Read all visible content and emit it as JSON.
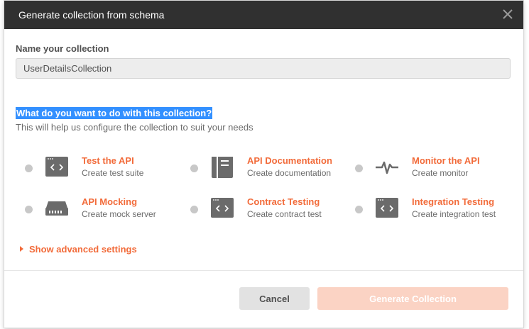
{
  "modal": {
    "title": "Generate collection from schema",
    "close_icon": "close-icon"
  },
  "form": {
    "name_label": "Name your collection",
    "name_value": "UserDetailsCollection",
    "question": "What do you want to do with this collection?",
    "helper": "This will help us configure the collection to suit your needs"
  },
  "options": [
    {
      "title": "Test the API",
      "desc": "Create test suite",
      "icon": "code-window-icon"
    },
    {
      "title": "API Documentation",
      "desc": "Create documentation",
      "icon": "document-icon"
    },
    {
      "title": "Monitor the API",
      "desc": "Create monitor",
      "icon": "pulse-icon"
    },
    {
      "title": "API Mocking",
      "desc": "Create mock server",
      "icon": "server-icon"
    },
    {
      "title": "Contract Testing",
      "desc": "Create contract test",
      "icon": "code-window-icon"
    },
    {
      "title": "Integration Testing",
      "desc": "Create integration test",
      "icon": "code-window-icon"
    }
  ],
  "advanced": {
    "label": "Show advanced settings"
  },
  "footer": {
    "cancel_label": "Cancel",
    "generate_label": "Generate Collection"
  },
  "colors": {
    "accent": "#f26b3a",
    "header_bg": "#303030",
    "generate_disabled": "#fbd3c4",
    "selection": "#3390ff"
  }
}
